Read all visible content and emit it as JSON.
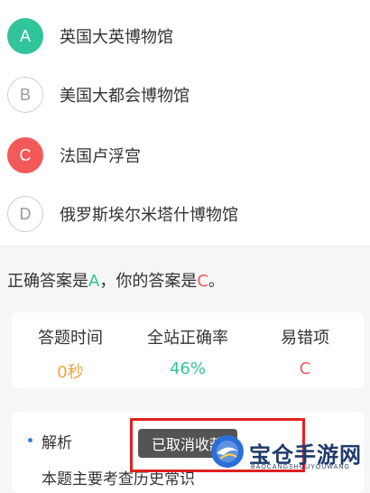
{
  "options": [
    {
      "letter": "A",
      "text": "英国大英博物馆",
      "state": "correct"
    },
    {
      "letter": "B",
      "text": "美国大都会博物馆",
      "state": "plain"
    },
    {
      "letter": "C",
      "text": "法国卢浮宫",
      "state": "wrong"
    },
    {
      "letter": "D",
      "text": "俄罗斯埃尔米塔什博物馆",
      "state": "plain"
    }
  ],
  "answer": {
    "prefix": "正确答案是",
    "correct": "A",
    "middle": "，你的答案是",
    "yours": "C",
    "suffix": "。"
  },
  "stats": {
    "time_label": "答题时间",
    "time_value": "0秒",
    "rate_label": "全站正确率",
    "rate_value": "46%",
    "error_label": "易错项",
    "error_value": "C"
  },
  "analysis": {
    "title": "解析",
    "body": "本题主要考查历史常识"
  },
  "toast": {
    "text": "已取消收藏"
  },
  "watermark": {
    "text": "宝仓手游网",
    "sub": "BAOCANGSHOUYOUWANG"
  },
  "colors": {
    "correct": "#32c49a",
    "wrong": "#f25a5a",
    "time": "#f0a43a",
    "highlight": "#e0201e"
  }
}
